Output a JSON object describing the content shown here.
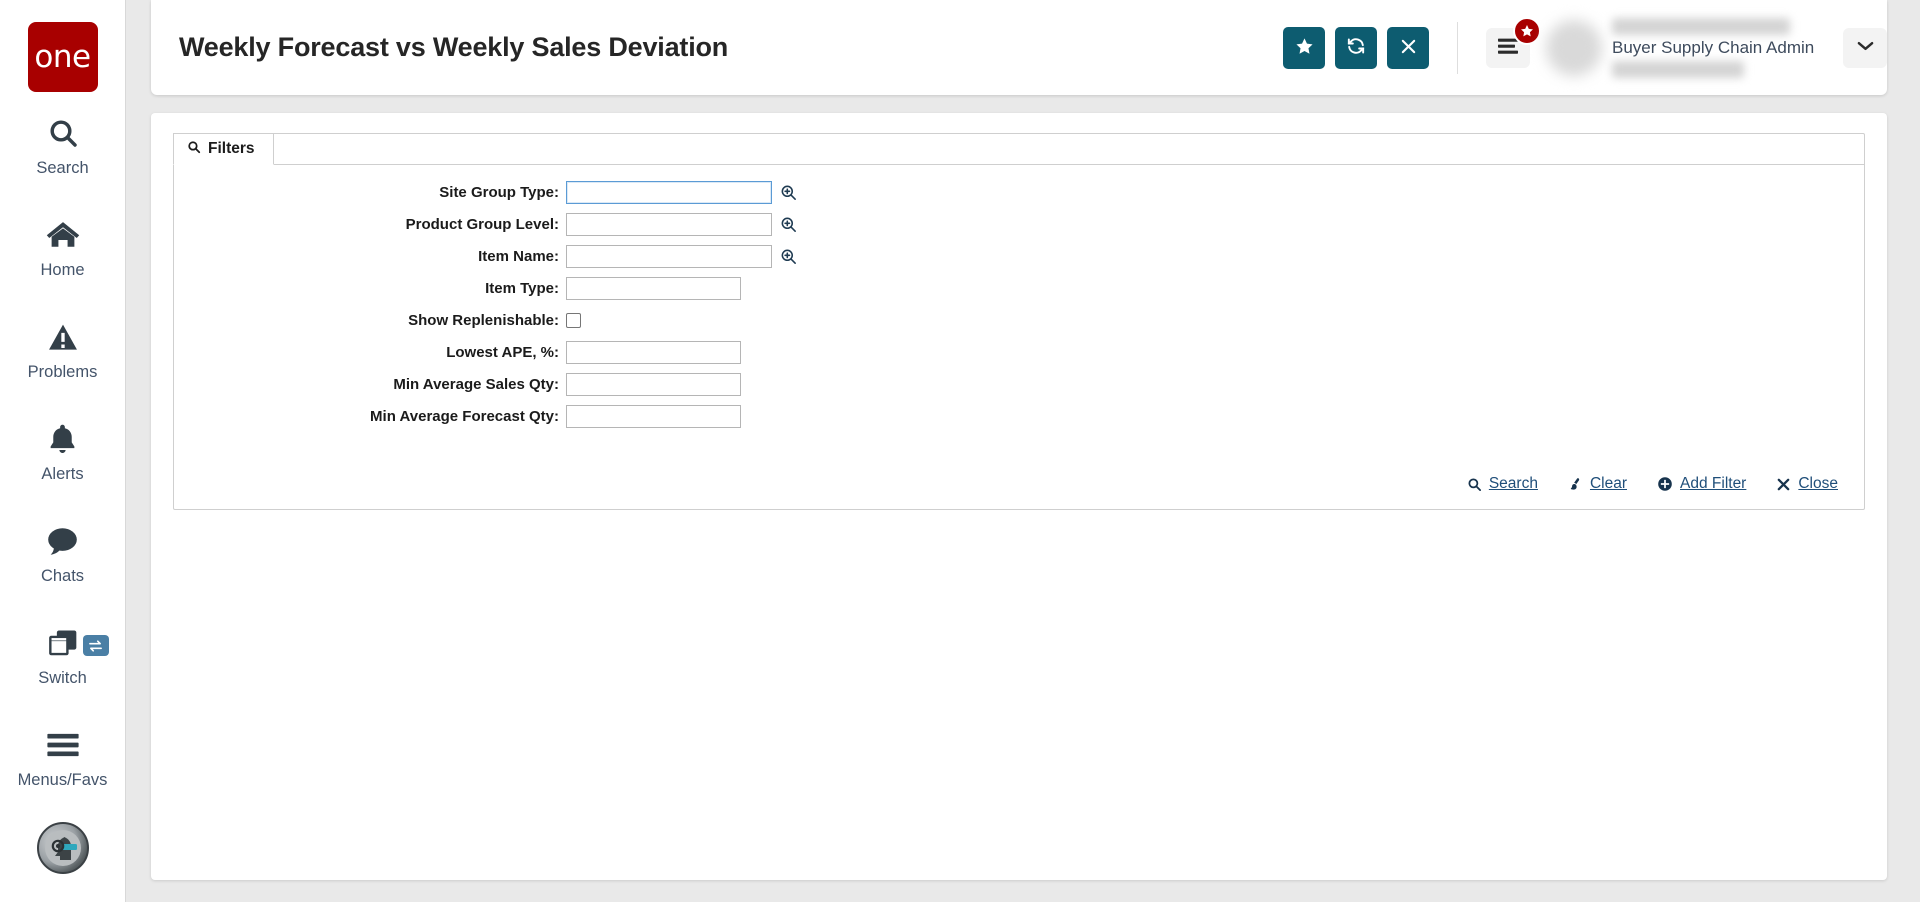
{
  "brand": {
    "logo_text": "one"
  },
  "sidebar": {
    "items": [
      {
        "label": "Search",
        "icon": "search-icon"
      },
      {
        "label": "Home",
        "icon": "home-icon"
      },
      {
        "label": "Problems",
        "icon": "warning-triangle-icon"
      },
      {
        "label": "Alerts",
        "icon": "bell-icon"
      },
      {
        "label": "Chats",
        "icon": "chat-bubble-icon"
      },
      {
        "label": "Switch",
        "icon": "windows-stack-icon"
      },
      {
        "label": "Menus/Favs",
        "icon": "hamburger-icon"
      }
    ],
    "bottom_avatar": "ai-assistant-avatar-icon"
  },
  "header": {
    "title": "Weekly Forecast vs Weekly Sales Deviation",
    "buttons": [
      {
        "name": "favorite-button",
        "icon": "star-icon"
      },
      {
        "name": "refresh-button",
        "icon": "refresh-icon"
      },
      {
        "name": "close-button",
        "icon": "close-x-icon"
      }
    ],
    "menu": {
      "icon": "hamburger-menu-icon",
      "badge_icon": "star-icon"
    },
    "user": {
      "role": "Buyer Supply Chain Admin",
      "name_redacted": true
    },
    "dropdown_icon": "chevron-down-icon",
    "accent_color": "#0d5c70",
    "badge_color": "#a80000"
  },
  "filters": {
    "tab_label": "Filters",
    "tab_icon": "search-icon",
    "fields": [
      {
        "label": "Site Group Type:",
        "type": "text",
        "value": "",
        "width": "wide",
        "lookup": true,
        "focused": true
      },
      {
        "label": "Product Group Level:",
        "type": "text",
        "value": "",
        "width": "wide",
        "lookup": true,
        "focused": false
      },
      {
        "label": "Item Name:",
        "type": "text",
        "value": "",
        "width": "wide",
        "lookup": true,
        "focused": false
      },
      {
        "label": "Item Type:",
        "type": "text",
        "value": "",
        "width": "narrow",
        "lookup": false,
        "focused": false
      },
      {
        "label": "Show Replenishable:",
        "type": "checkbox",
        "checked": false,
        "lookup": false,
        "focused": false
      },
      {
        "label": "Lowest APE, %:",
        "type": "text",
        "value": "",
        "width": "narrow",
        "lookup": false,
        "focused": false
      },
      {
        "label": "Min Average Sales Qty:",
        "type": "text",
        "value": "",
        "width": "narrow",
        "lookup": false,
        "focused": false
      },
      {
        "label": "Min Average Forecast Qty:",
        "type": "text",
        "value": "",
        "width": "narrow",
        "lookup": false,
        "focused": false
      }
    ],
    "actions": [
      {
        "label": "Search",
        "icon": "search-icon"
      },
      {
        "label": "Clear",
        "icon": "eraser-icon"
      },
      {
        "label": "Add Filter",
        "icon": "plus-circle-icon"
      },
      {
        "label": "Close",
        "icon": "close-x-icon"
      }
    ],
    "link_color": "#1f4e79"
  }
}
